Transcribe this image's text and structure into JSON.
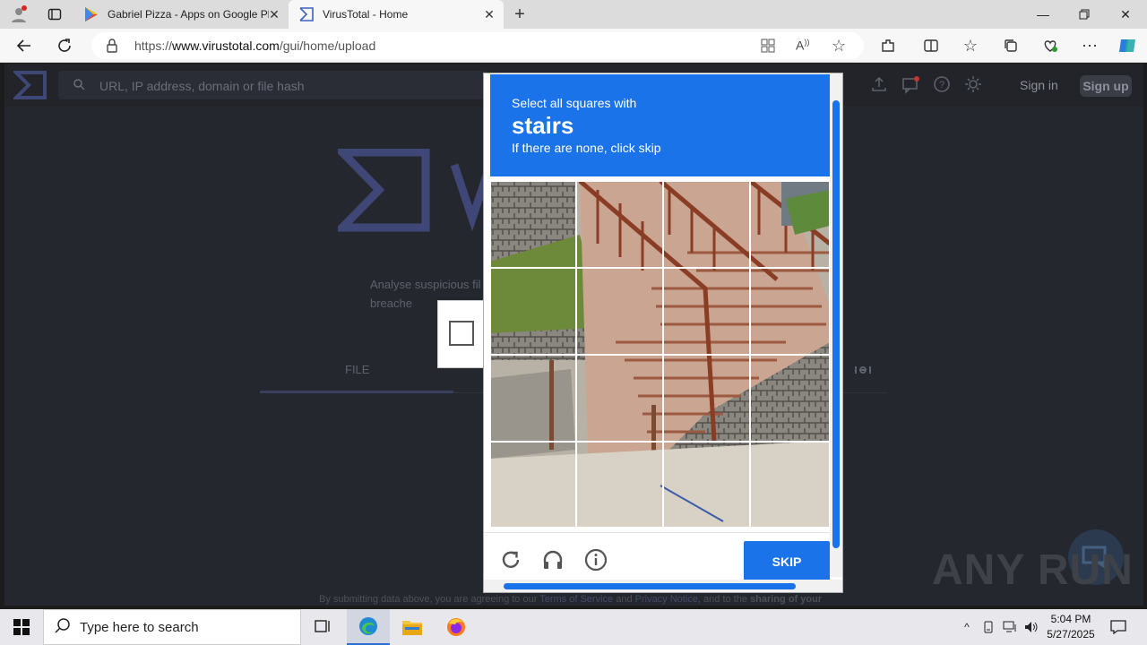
{
  "browser": {
    "tabs": [
      {
        "title": "Gabriel Pizza - Apps on Google Play",
        "active": false
      },
      {
        "title": "VirusTotal - Home",
        "active": true
      }
    ],
    "url_prefix": "https://",
    "url_host": "www.virustotal.com",
    "url_path": "/gui/home/upload"
  },
  "vt": {
    "search_placeholder": "URL, IP address, domain or file hash",
    "sign_in": "Sign in",
    "sign_up": "Sign up",
    "tagline": "Analyse suspicious fil breache",
    "file_tab": "FILE",
    "footer_prefix": "By submitting data above, you are agreeing to our ",
    "footer_tos": "Terms of Service",
    "footer_and": " and ",
    "footer_privacy": "Privacy Notice",
    "footer_suffix": ", and to the ",
    "footer_bold": "sharing of your"
  },
  "captcha": {
    "line1": "Select all squares with",
    "target_word": "stairs",
    "line3": "If there are none, click skip",
    "skip_label": "SKIP",
    "accent_color": "#1a73e8"
  },
  "watermark": "ANY RUN",
  "taskbar": {
    "search_text": "Type here to search",
    "time": "5:04 PM",
    "date": "5/27/2025"
  }
}
